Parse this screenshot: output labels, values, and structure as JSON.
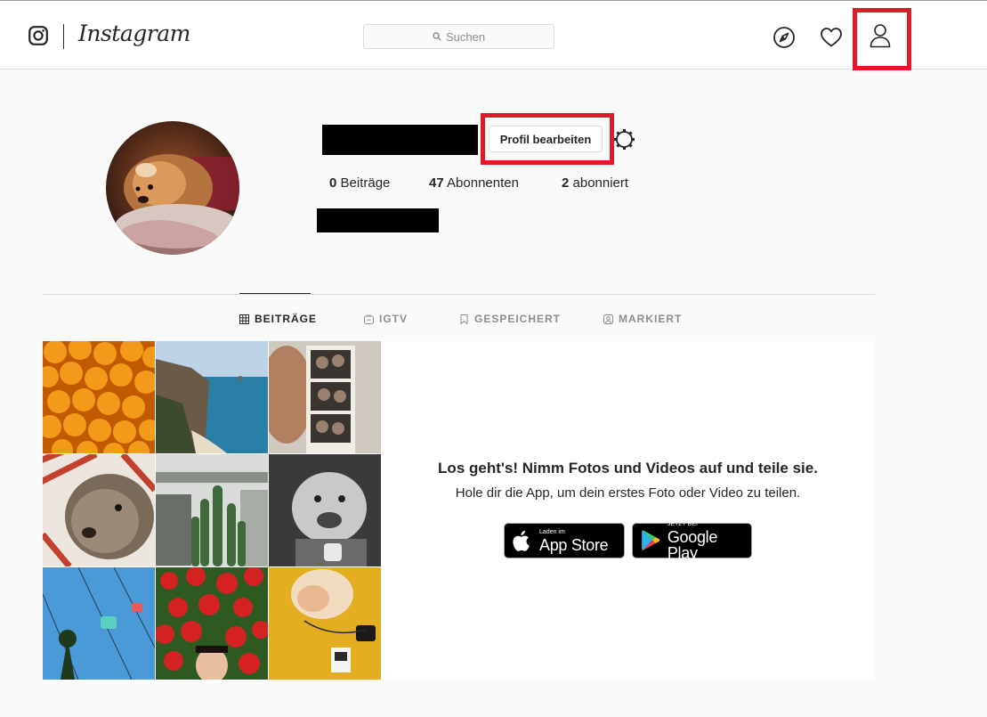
{
  "header": {
    "brand": "Instagram",
    "search_placeholder": "Suchen",
    "icons": [
      "instagram-glyph-icon",
      "search-icon",
      "compass-icon",
      "heart-icon",
      "person-icon"
    ]
  },
  "profile": {
    "edit_button": "Profil bearbeiten",
    "stats": {
      "posts_count": "0",
      "posts_label": "Beiträge",
      "followers_count": "47",
      "followers_label": "Abonnenten",
      "following_count": "2",
      "following_label": "abonniert"
    }
  },
  "tabs": [
    {
      "label": "BEITRÄGE",
      "icon": "grid-icon",
      "active": true
    },
    {
      "label": "IGTV",
      "icon": "igtv-icon",
      "active": false
    },
    {
      "label": "GESPEICHERT",
      "icon": "bookmark-icon",
      "active": false
    },
    {
      "label": "MARKIERT",
      "icon": "tagged-icon",
      "active": false
    }
  ],
  "promo": {
    "title": "Los geht's! Nimm Fotos und Videos auf und teile sie.",
    "subtitle": "Hole dir die App, um dein erstes Foto oder Video zu teilen.",
    "appstore_small": "Laden im",
    "appstore_big": "App Store",
    "googleplay_small": "JETZT BEI",
    "googleplay_big": "Google Play"
  },
  "colors": {
    "highlight": "#e11a2b",
    "text": "#262626",
    "muted": "#8e8e8e",
    "border": "#dbdbdb",
    "background": "#fafafa"
  }
}
